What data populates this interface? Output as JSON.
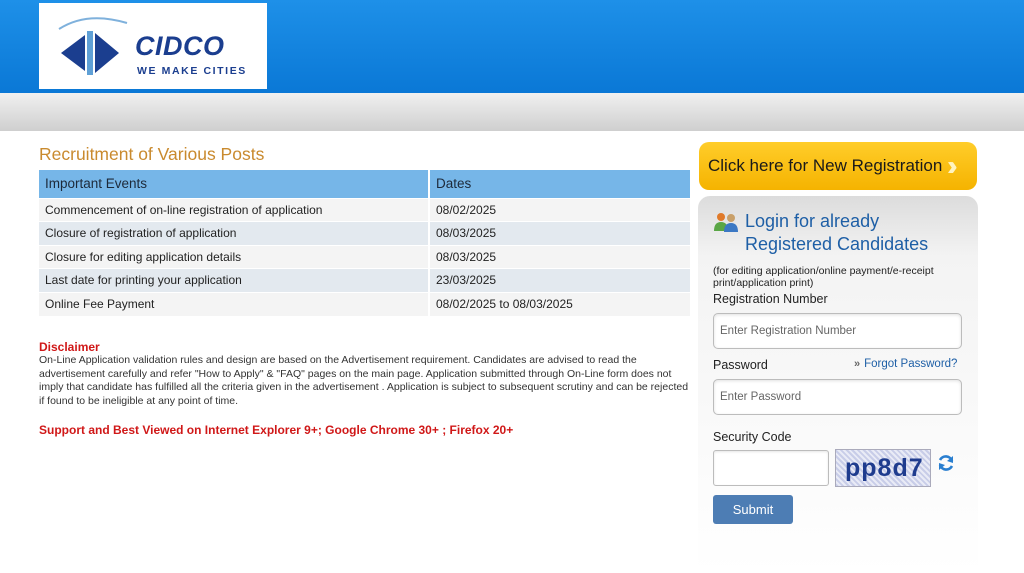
{
  "header": {
    "brand_name": "CIDCO",
    "brand_tagline": "WE MAKE CITIES",
    "brand_color": "#1b3e8f",
    "header_color": "#0a78d6"
  },
  "main": {
    "title": "Recruitment of Various Posts",
    "table": {
      "headers": [
        "Important Events",
        "Dates"
      ],
      "rows": [
        [
          "Commencement of on-line registration of application",
          "08/02/2025"
        ],
        [
          "Closure of registration of application",
          "08/03/2025"
        ],
        [
          "Closure for editing application details",
          "08/03/2025"
        ],
        [
          "Last date for printing your application",
          "23/03/2025"
        ],
        [
          "Online Fee Payment",
          "08/02/2025 to 08/03/2025"
        ]
      ]
    },
    "disclaimer_title": "Disclaimer",
    "disclaimer_text": "On-Line Application validation rules and design are based on the Advertisement requirement. Candidates are advised to read the advertisement carefully and refer \"How to Apply\" & \"FAQ\" pages on the main page. Application submitted through On-Line form does not imply that candidate has fulfilled all the criteria given in the advertisement . Application is subject to subsequent scrutiny and can be rejected if found to be ineligible at any point of time.",
    "support_text": "Support and Best Viewed on Internet Explorer 9+; Google Chrome 30+ ; Firefox 20+",
    "title_color": "#c98a2e",
    "alert_color": "#d01818"
  },
  "sidebar": {
    "new_registration_label": "Click here for New Registration",
    "login_title_line1": "Login for already",
    "login_title_line2": "Registered Candidates",
    "login_note": "(for editing application/online payment/e-receipt print/application print)",
    "registration_label": "Registration Number",
    "registration_placeholder": "Enter Registration Number",
    "password_label": "Password",
    "password_placeholder": "Enter Password",
    "forgot_password": "Forgot Password?",
    "security_label": "Security Code",
    "captcha_text": "pp8d7",
    "submit_label": "Submit",
    "icons": [
      "users-icon",
      "refresh-icon",
      "double-chevron-icon"
    ],
    "accent_color": "#f5b300",
    "button_color": "#4d7db4"
  }
}
